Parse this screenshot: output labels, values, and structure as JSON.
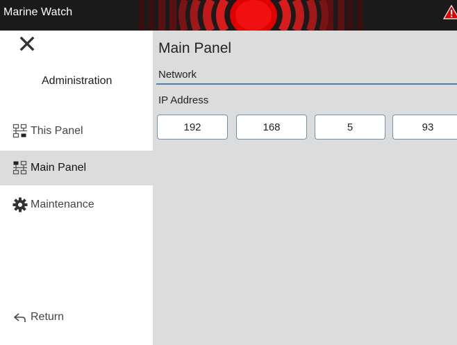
{
  "header": {
    "app_title": "Marine Watch",
    "alarm_color": "#e00000",
    "warning_icon": "warning-triangle-icon"
  },
  "sidebar": {
    "close_icon": "close-icon",
    "section_title": "Administration",
    "items": [
      {
        "label": "This Panel",
        "icon": "network-icon",
        "active": false
      },
      {
        "label": "Main Panel",
        "icon": "network-icon",
        "active": true
      },
      {
        "label": "Maintenance",
        "icon": "gear-icon",
        "active": false
      }
    ],
    "return_label": "Return",
    "return_icon": "return-arrow-icon"
  },
  "main": {
    "title": "Main Panel",
    "section": "Network",
    "ip_label": "IP Address",
    "ip_octets": [
      "192",
      "168",
      "5",
      "93"
    ]
  },
  "colors": {
    "topbar_bg": "#1a1a1a",
    "content_bg": "#dcdcdc",
    "accent_line": "#4f7da6",
    "active_item_bg": "#dcdcdc"
  }
}
